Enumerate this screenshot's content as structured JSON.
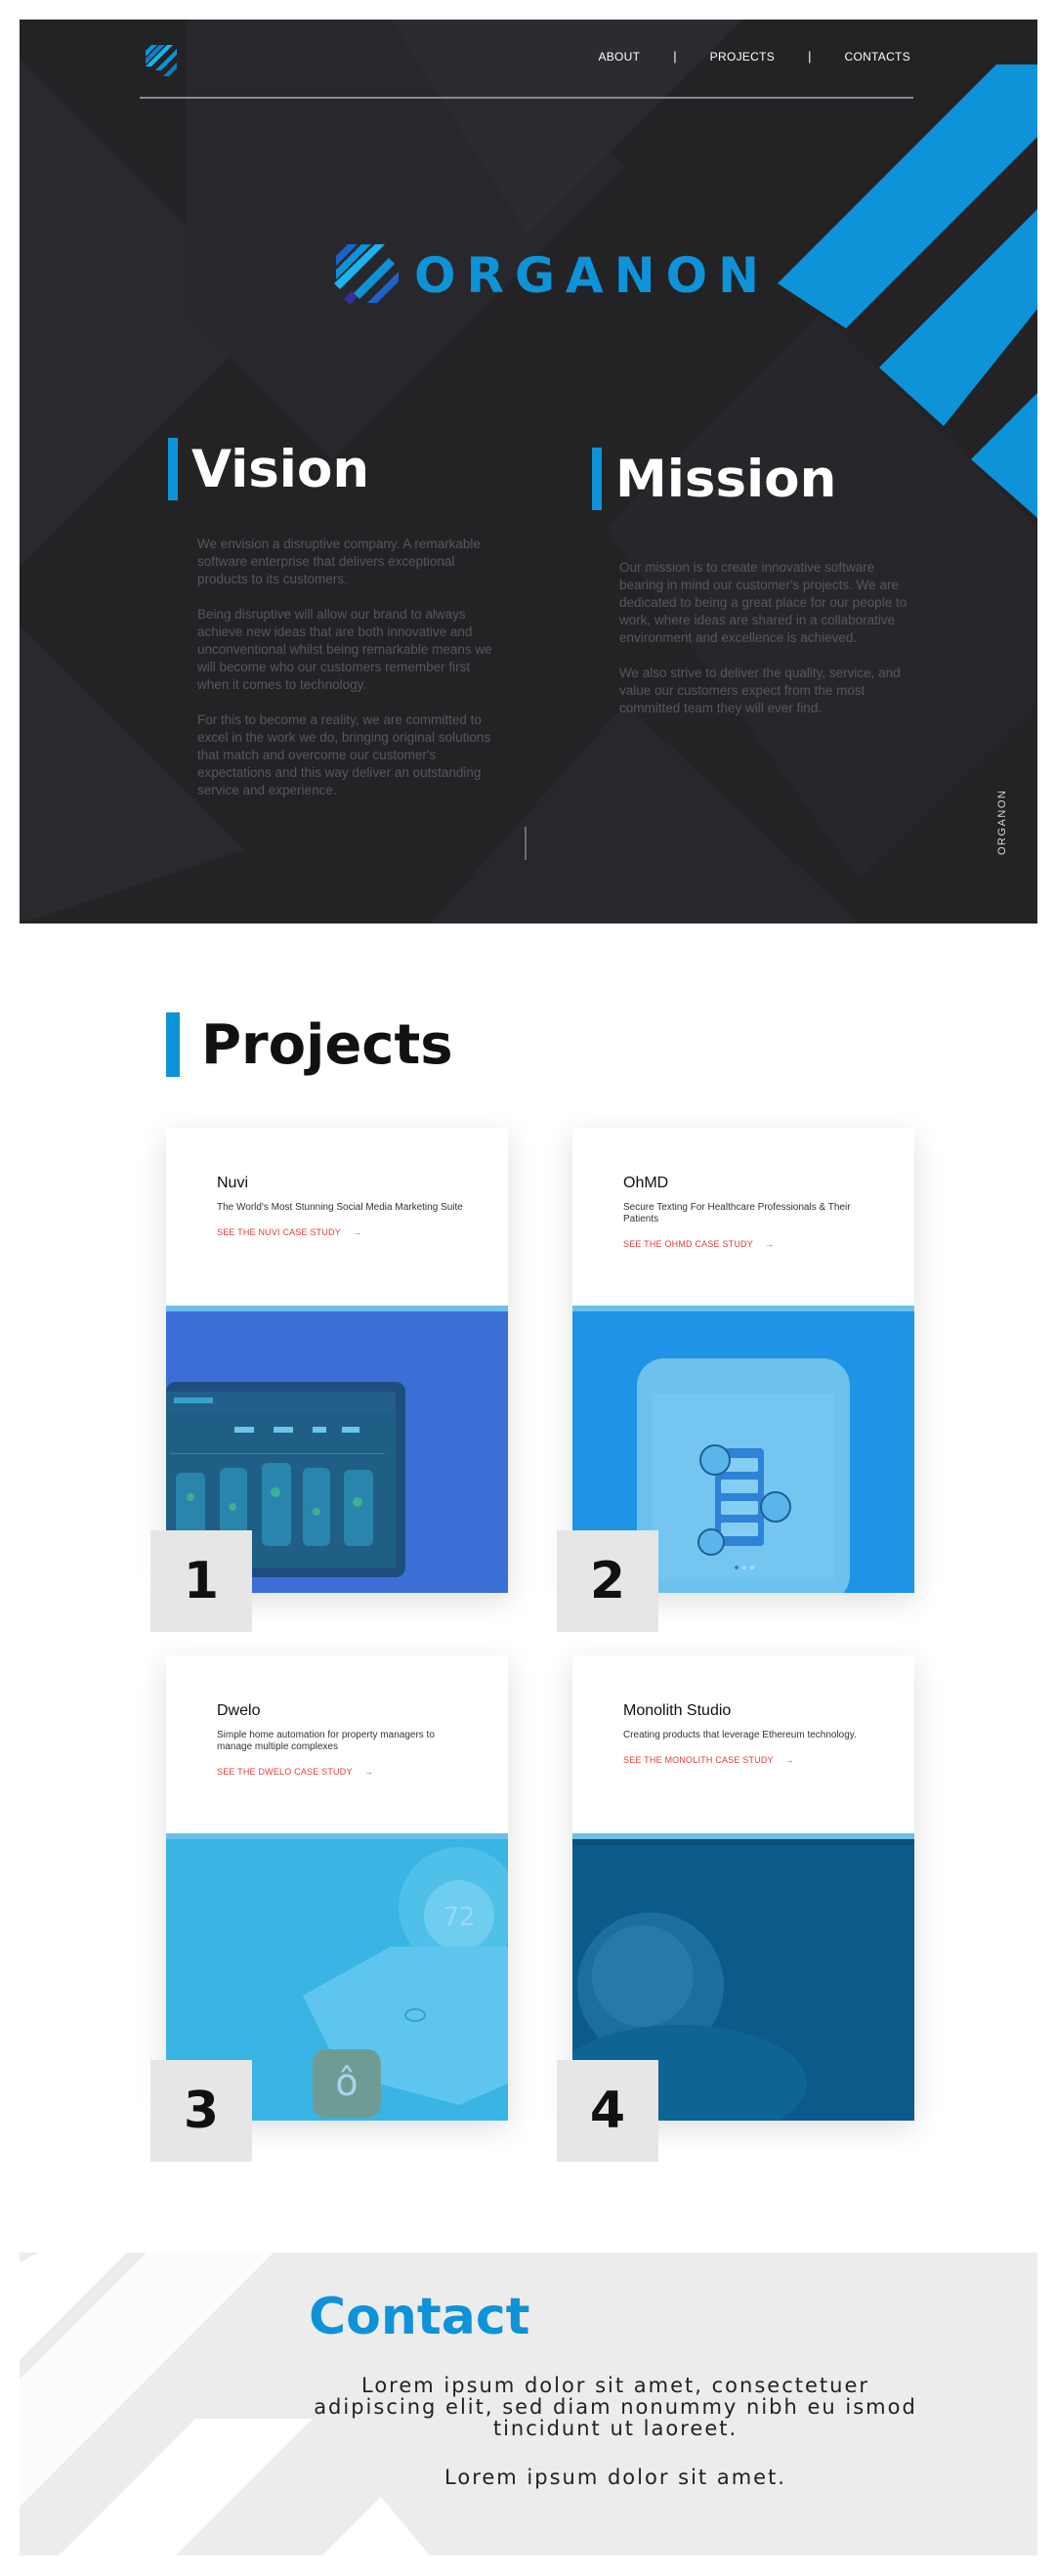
{
  "colors": {
    "accent": "#0e93d8",
    "hero_background": "#232326",
    "link_red": "#e33a3a",
    "contact_background": "#ececec"
  },
  "nav": {
    "logo_icon": "organon-logo-icon",
    "items": [
      {
        "label": "ABOUT"
      },
      {
        "label": "PROJECTS"
      },
      {
        "label": "CONTACTS"
      }
    ],
    "separator": "|"
  },
  "hero": {
    "brand_name": "ORGANON",
    "side_brand": "ORGANON",
    "vision": {
      "title": "Vision",
      "paragraphs": [
        "We envision a disruptive company. A remarkable software enterprise that delivers exceptional products to its customers.",
        "Being disruptive will allow our brand to always achieve new ideas that are both innovative and unconventional whilst being remarkable means we will become who our customers remember first when it comes to technology.",
        "For this to become a reality, we are committed to excel in the work we do, bringing original solutions that match and overcome our customer's expectations and this way deliver an outstanding service and experience."
      ]
    },
    "mission": {
      "title": "Mission",
      "paragraphs": [
        "Our mission is to create innovative software bearing in mind our customer's projects. We are dedicated to being a great place for our people to work, where ideas are shared in a collaborative environment and excellence is achieved.",
        "We also strive to deliver the quality, service, and value our customers expect from the most committed team they will ever find."
      ]
    }
  },
  "projects": {
    "title": "Projects",
    "items": [
      {
        "number": "1",
        "title": "Nuvi",
        "description": "The World's Most Stunning Social Media Marketing Suite",
        "link": "SEE THE NUVI CASE STUDY",
        "arrow": "→"
      },
      {
        "number": "2",
        "title": "OhMD",
        "description": "Secure Texting For Healthcare Professionals & Their Patients",
        "link": "SEE THE OHMD CASE STUDY",
        "arrow": "→"
      },
      {
        "number": "3",
        "title": "Dwelo",
        "description": "Simple home automation for property managers to manage multiple complexes",
        "link": "SEE THE DWELO CASE STUDY",
        "arrow": "→",
        "media_value": "72"
      },
      {
        "number": "4",
        "title": "Monolith Studio",
        "description": "Creating products that leverage Ethereum technology.",
        "link": "SEE THE MONOLITH CASE STUDY",
        "arrow": "→"
      }
    ]
  },
  "contact": {
    "title": "Contact",
    "text": "Lorem ipsum dolor sit amet, consectetuer adipiscing elit, sed diam nonummy nibh eu ismod tincidunt ut laoreet.",
    "text2": "Lorem ipsum dolor sit amet."
  }
}
